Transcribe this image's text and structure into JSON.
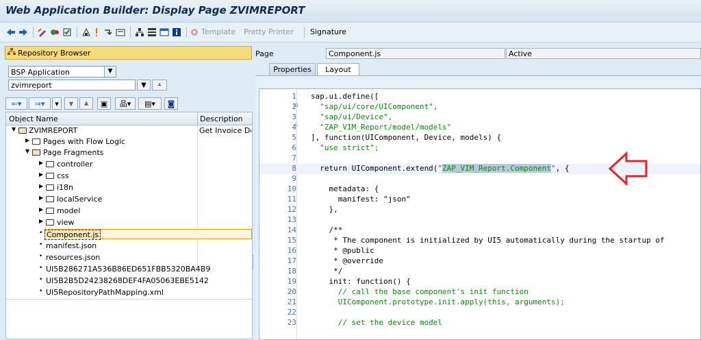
{
  "window": {
    "title": "Web Application Builder: Display Page ZVIMREPORT"
  },
  "toolbar": {
    "icons": [
      "back-arrow-icon",
      "forward-arrow-icon",
      "edit-toggle-icon",
      "other-object-icon",
      "check-icon",
      "activate-icon",
      "test-icon",
      "where-used-icon",
      "display-object-list-icon",
      "navigation-window-icon",
      "layout-icon",
      "info-icon",
      "version-icon"
    ],
    "template_label": "Template",
    "pretty_printer_label": "Pretty Printer",
    "signature_label": "Signature"
  },
  "repo": {
    "header": "Repository Browser",
    "type_value": "BSP Application",
    "object_value": "zvimreport",
    "tree_header_name": "Object Name",
    "tree_header_desc": "Description",
    "items": [
      {
        "label": "ZVIMREPORT",
        "desc": "Get Invoice Det",
        "kind": "app"
      },
      {
        "label": "Pages with Flow Logic",
        "desc": "",
        "kind": "folder"
      },
      {
        "label": "Page Fragments",
        "desc": "",
        "kind": "folder-open"
      },
      {
        "label": "controller",
        "desc": "",
        "kind": "folder"
      },
      {
        "label": "css",
        "desc": "",
        "kind": "folder"
      },
      {
        "label": "i18n",
        "desc": "",
        "kind": "folder"
      },
      {
        "label": "localService",
        "desc": "",
        "kind": "folder"
      },
      {
        "label": "model",
        "desc": "",
        "kind": "folder"
      },
      {
        "label": "view",
        "desc": "",
        "kind": "folder"
      },
      {
        "label": "Component.js",
        "desc": "",
        "kind": "file-selected"
      },
      {
        "label": "manifest.json",
        "desc": "",
        "kind": "file"
      },
      {
        "label": "resources.json",
        "desc": "",
        "kind": "file"
      },
      {
        "label": "UI5B286271A536B86ED651FBB5320BA4B9",
        "desc": "",
        "kind": "file"
      },
      {
        "label": "UI5B2B5D24238268DEF4FA05063EBE5142",
        "desc": "",
        "kind": "file"
      },
      {
        "label": "UI5RepositoryPathMapping.xml",
        "desc": "",
        "kind": "file"
      }
    ]
  },
  "page": {
    "label": "Page",
    "name": "Component.js",
    "status": "Active",
    "tabs": [
      "Properties",
      "Layout"
    ],
    "active_tab": "Layout"
  },
  "code_lines": [
    {
      "n": "1",
      "text": "sap.ui.define(["
    },
    {
      "n": "2",
      "text": "  \"sap/ui/core/UIComponent\","
    },
    {
      "n": "3",
      "text": "  \"sap/ui/Device\","
    },
    {
      "n": "4",
      "text": "  \"ZAP_VIM_Report/model/models\""
    },
    {
      "n": "5",
      "text": "], function(UIComponent, Device, models) {"
    },
    {
      "n": "6",
      "text": "  \"use strict\";"
    },
    {
      "n": "7",
      "text": ""
    },
    {
      "n": "8",
      "text": "  return UIComponent.extend(\"ZAP_VIM_Report.Component\", {"
    },
    {
      "n": "9",
      "text": ""
    },
    {
      "n": "10",
      "text": "    metadata: {"
    },
    {
      "n": "11",
      "text": "      manifest: \"json\""
    },
    {
      "n": "12",
      "text": "    },"
    },
    {
      "n": "13",
      "text": ""
    },
    {
      "n": "14",
      "text": "    /**"
    },
    {
      "n": "15",
      "text": "     * The component is initialized by UI5 automatically during the startup of"
    },
    {
      "n": "16",
      "text": "     * @public"
    },
    {
      "n": "17",
      "text": "     * @override"
    },
    {
      "n": "18",
      "text": "     */"
    },
    {
      "n": "19",
      "text": "    init: function() {"
    },
    {
      "n": "20",
      "text": "      // call the base component's init function"
    },
    {
      "n": "21",
      "text": "      UIComponent.prototype.init.apply(this, arguments);"
    },
    {
      "n": "22",
      "text": ""
    },
    {
      "n": "23",
      "text": "      // set the device model"
    }
  ],
  "colors": {
    "arrow": "#e8202a",
    "string": "#0a8a0a",
    "line_number": "#3a73b6"
  }
}
